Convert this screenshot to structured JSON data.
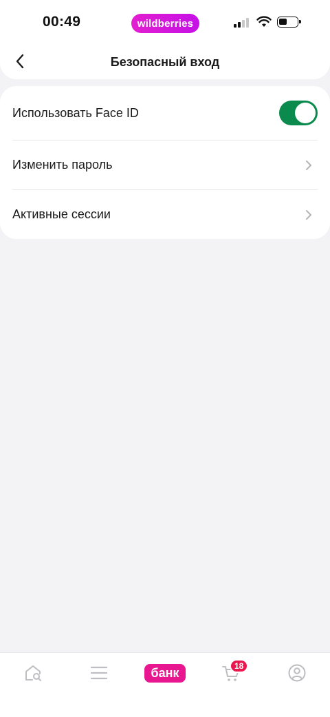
{
  "status_bar": {
    "time": "00:49",
    "brand": "wildberries"
  },
  "header": {
    "title": "Безопасный вход"
  },
  "settings": {
    "face_id": {
      "label": "Использовать Face ID",
      "enabled": true
    },
    "change_password": {
      "label": "Изменить пароль"
    },
    "active_sessions": {
      "label": "Активные сессии"
    }
  },
  "bottom_nav": {
    "bank_label": "банк",
    "cart_count": "18"
  },
  "colors": {
    "toggle_on": "#0a8a4c",
    "brand_pink": "#e8178f",
    "badge_red": "#e8174e"
  },
  "icons": [
    "back-arrow-icon",
    "signal-icon",
    "wifi-icon",
    "battery-icon",
    "chevron-right-icon",
    "home-search-icon",
    "menu-icon",
    "cart-icon",
    "profile-icon"
  ]
}
